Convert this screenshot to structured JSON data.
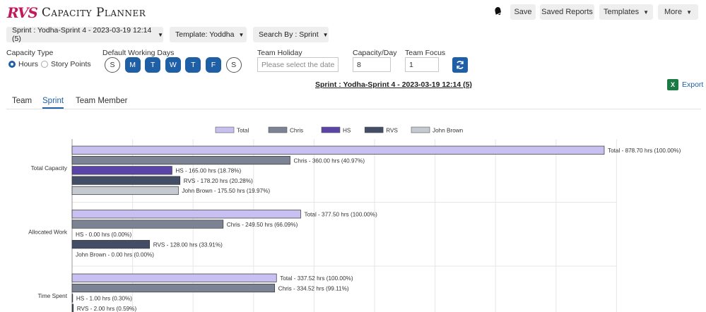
{
  "app": {
    "logo": "RVS",
    "title": "Capacity Planner"
  },
  "header": {
    "save": "Save",
    "saved_reports": "Saved Reports",
    "templates": "Templates",
    "more": "More"
  },
  "filters": {
    "sprint": "Sprint : Yodha-Sprint 4 - 2023-03-19 12:14 (5)",
    "template": "Template: Yoddha",
    "search_by": "Search By : Sprint"
  },
  "settings": {
    "capacity_type_label": "Capacity Type",
    "hours": "Hours",
    "story_points": "Story Points",
    "selected_type": "Hours",
    "working_days_label": "Default Working Days",
    "days": [
      {
        "label": "S",
        "on": false
      },
      {
        "label": "M",
        "on": true
      },
      {
        "label": "T",
        "on": true
      },
      {
        "label": "W",
        "on": true
      },
      {
        "label": "T",
        "on": true
      },
      {
        "label": "F",
        "on": true
      },
      {
        "label": "S",
        "on": false
      }
    ],
    "team_holiday_label": "Team Holiday",
    "team_holiday_placeholder": "Please select the date",
    "capacity_day_label": "Capacity/Day",
    "capacity_day_value": "8",
    "team_focus_label": "Team Focus",
    "team_focus_value": "1"
  },
  "report": {
    "heading": "Sprint : Yodha-Sprint 4 - 2023-03-19 12:14 (5)",
    "export": "Export"
  },
  "tabs": [
    {
      "label": "Team",
      "active": false
    },
    {
      "label": "Sprint",
      "active": true
    },
    {
      "label": "Team Member",
      "active": false
    }
  ],
  "colors": {
    "accent": "#1f5fa6",
    "brand": "#c2185b"
  },
  "chart_data": {
    "type": "bar",
    "orientation": "horizontal",
    "legend_position": "top",
    "grid": true,
    "xlim": [
      0,
      878.7
    ],
    "categories": [
      "Total Capacity",
      "Allocated Work",
      "Time Spent"
    ],
    "series": [
      {
        "name": "Total",
        "color": "#c8c0f0",
        "values": [
          878.7,
          377.5,
          337.52
        ],
        "labels": [
          "Total - 878.70 hrs (100.00%)",
          "Total - 377.50 hrs (100.00%)",
          "Total - 337.52 hrs (100.00%)"
        ]
      },
      {
        "name": "Chris",
        "color": "#7b8394",
        "values": [
          360.0,
          249.5,
          334.52
        ],
        "labels": [
          "Chris - 360.00 hrs (40.97%)",
          "Chris - 249.50 hrs (66.09%)",
          "Chris - 334.52 hrs (99.11%)"
        ]
      },
      {
        "name": "HS",
        "color": "#5a44a8",
        "values": [
          165.0,
          0.0,
          1.0
        ],
        "labels": [
          "HS - 165.00 hrs (18.78%)",
          "HS - 0.00 hrs (0.00%)",
          "HS - 1.00 hrs (0.30%)"
        ]
      },
      {
        "name": "RVS",
        "color": "#434d66",
        "values": [
          178.2,
          128.0,
          2.0
        ],
        "labels": [
          "RVS - 178.20 hrs (20.28%)",
          "RVS - 128.00 hrs (33.91%)",
          "RVS - 2.00 hrs (0.59%)"
        ]
      },
      {
        "name": "John Brown",
        "color": "#c5c9d0",
        "values": [
          175.5,
          0.0,
          null
        ],
        "labels": [
          "John Brown - 175.50 hrs (19.97%)",
          "John Brown - 0.00 hrs (0.00%)",
          ""
        ]
      }
    ]
  }
}
